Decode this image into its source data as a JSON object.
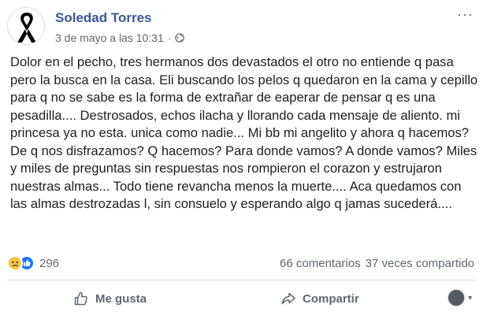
{
  "post": {
    "author": "Soledad Torres",
    "timestamp": "3 de mayo a las 10:31",
    "separator": "·",
    "privacy_icon": "globe-icon",
    "more_icon": "more-icon",
    "more_label": "···",
    "text": "Dolor en el pecho, tres hermanos dos devastados el otro no entiende q pasa pero la busca en la casa. Eli buscando los pelos q quedaron en la cama y cepillo para q no se sabe es la forma de extrañar de eaperar de pensar q es una pesadilla.... Destrosados, echos ilacha y llorando cada mensaje de aliento. mi princesa ya no esta. unica como nadie... Mi bb mi angelito y ahora q hacemos? De q nos disfrazamos? Q hacemos? Para donde vamos? A donde vamos? Miles y miles de preguntas sin respuestas nos rompieron el corazon y estrujaron nuestras almas... Todo tiene revancha menos la muerte.... Aca quedamos con las almas destrozadas l, sin consuelo y esperando algo q jamas sucederá...."
  },
  "stats": {
    "reaction_icons": [
      "sad-reaction-icon",
      "like-reaction-icon"
    ],
    "reaction_count": "296",
    "comments": "66 comentarios",
    "shares": "37 veces compartido"
  },
  "actions": {
    "like_label": "Me gusta",
    "share_label": "Compartir",
    "caret": "▾"
  },
  "colors": {
    "author": "#385898",
    "meta": "#606770",
    "like": "#1877f2",
    "sad": "#f7c544"
  }
}
